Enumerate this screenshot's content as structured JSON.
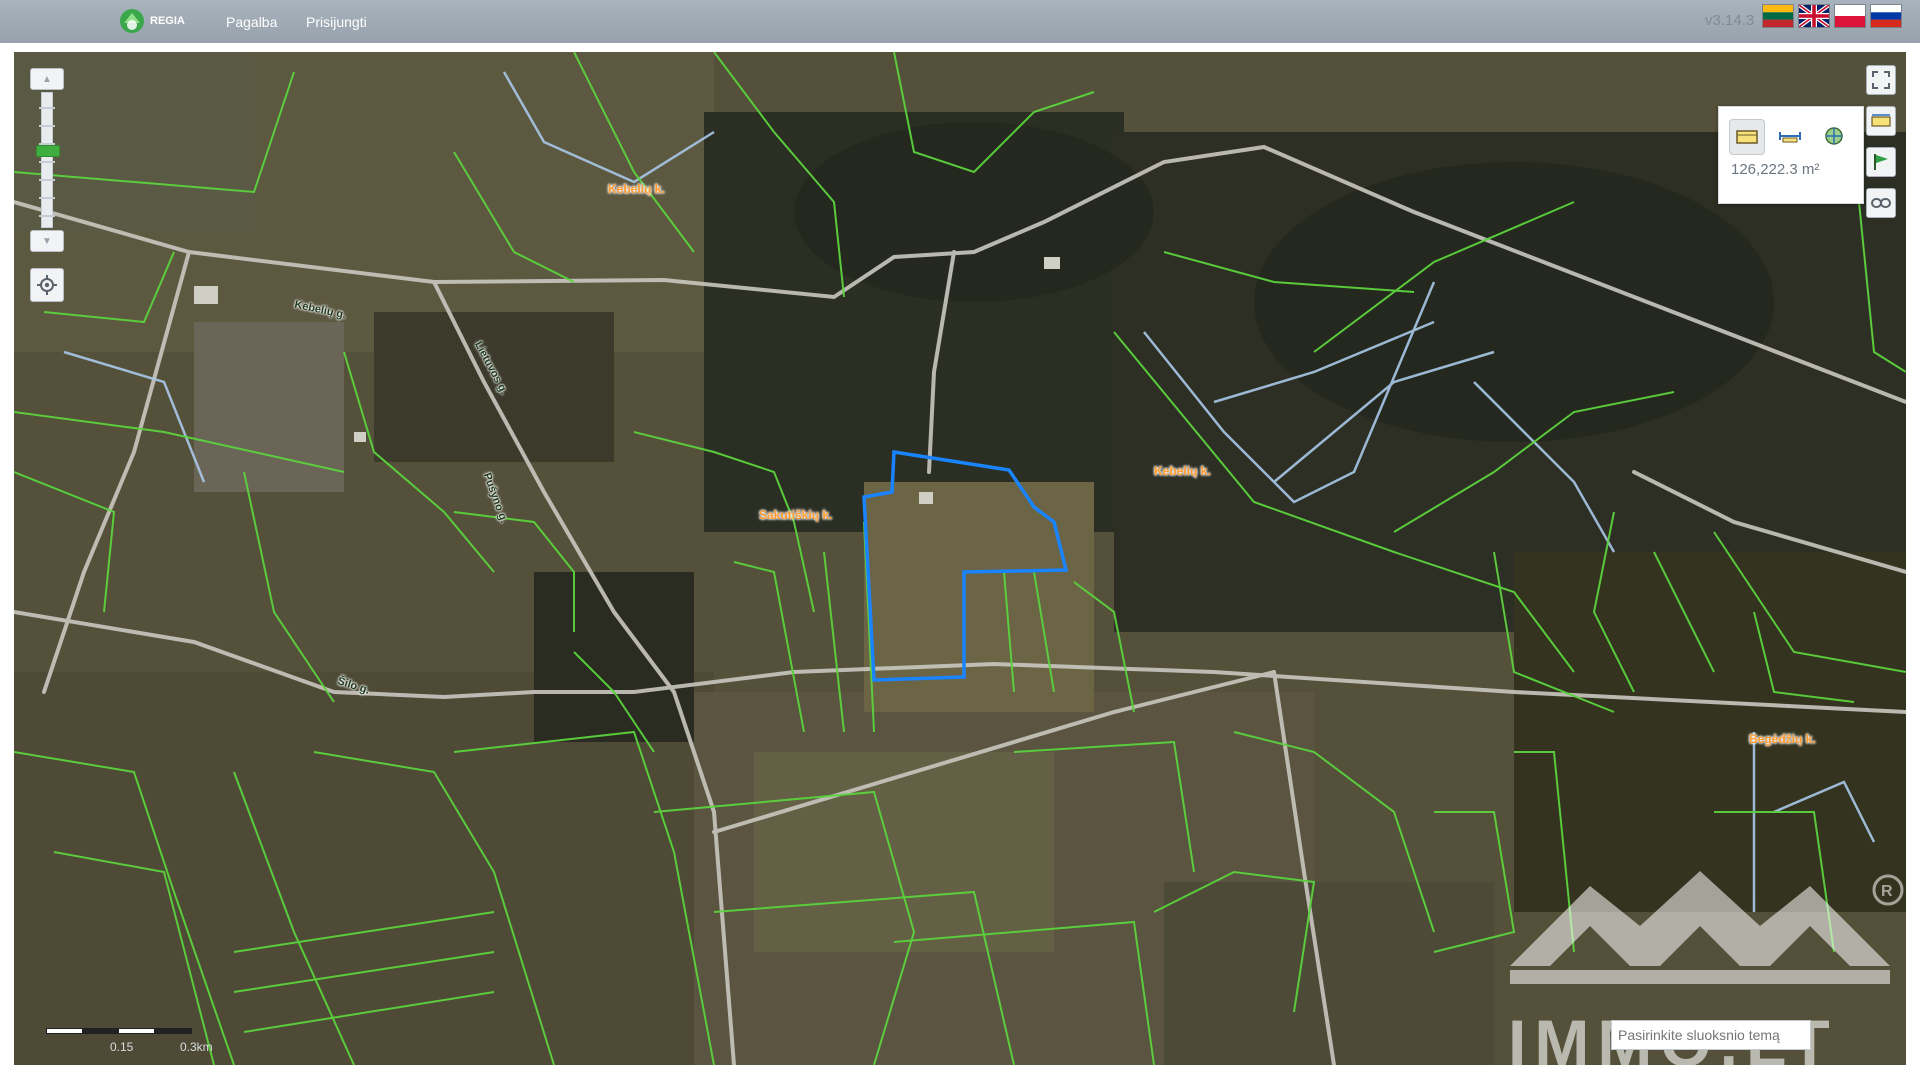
{
  "header": {
    "logo_text": "REGIA",
    "nav": [
      {
        "label": "Pagalba"
      },
      {
        "label": "Prisijungti"
      }
    ],
    "version": "v3.14.3",
    "languages": [
      {
        "code": "lt",
        "icon": "flag-lithuania-icon"
      },
      {
        "code": "en",
        "icon": "flag-uk-icon"
      },
      {
        "code": "pl",
        "icon": "flag-poland-icon"
      },
      {
        "code": "ru",
        "icon": "flag-russia-icon"
      }
    ]
  },
  "map": {
    "place_labels": [
      "Kebelių k.",
      "Kebelių k.",
      "Sakutiškių k.",
      "Begėdžių k."
    ],
    "street_labels": [
      "Kebelių g.",
      "Šilo g.",
      "Lietuvos g.",
      "Pušyno g."
    ],
    "measurement": {
      "value": "126,222.3 m²",
      "tools": [
        "measure-area-icon",
        "measure-distance-icon",
        "measure-point-icon"
      ]
    },
    "right_tools": [
      "fullscreen-icon",
      "measure-icon",
      "flag-icon",
      "link-icon"
    ],
    "zoom": {
      "level_fraction": 0.42
    },
    "scale": {
      "labels": [
        "0.15",
        "0.3km"
      ]
    },
    "layer_input": {
      "placeholder": "Pasirinkite sluoksnio temą"
    },
    "watermark": "IMMO.LT"
  },
  "colors": {
    "parcel_border": "#5bd33d",
    "selected_parcel": "#1a84ff",
    "place_label": "#ff9a2e",
    "water": "#a8c8e8",
    "road": "#c9c7c0"
  }
}
